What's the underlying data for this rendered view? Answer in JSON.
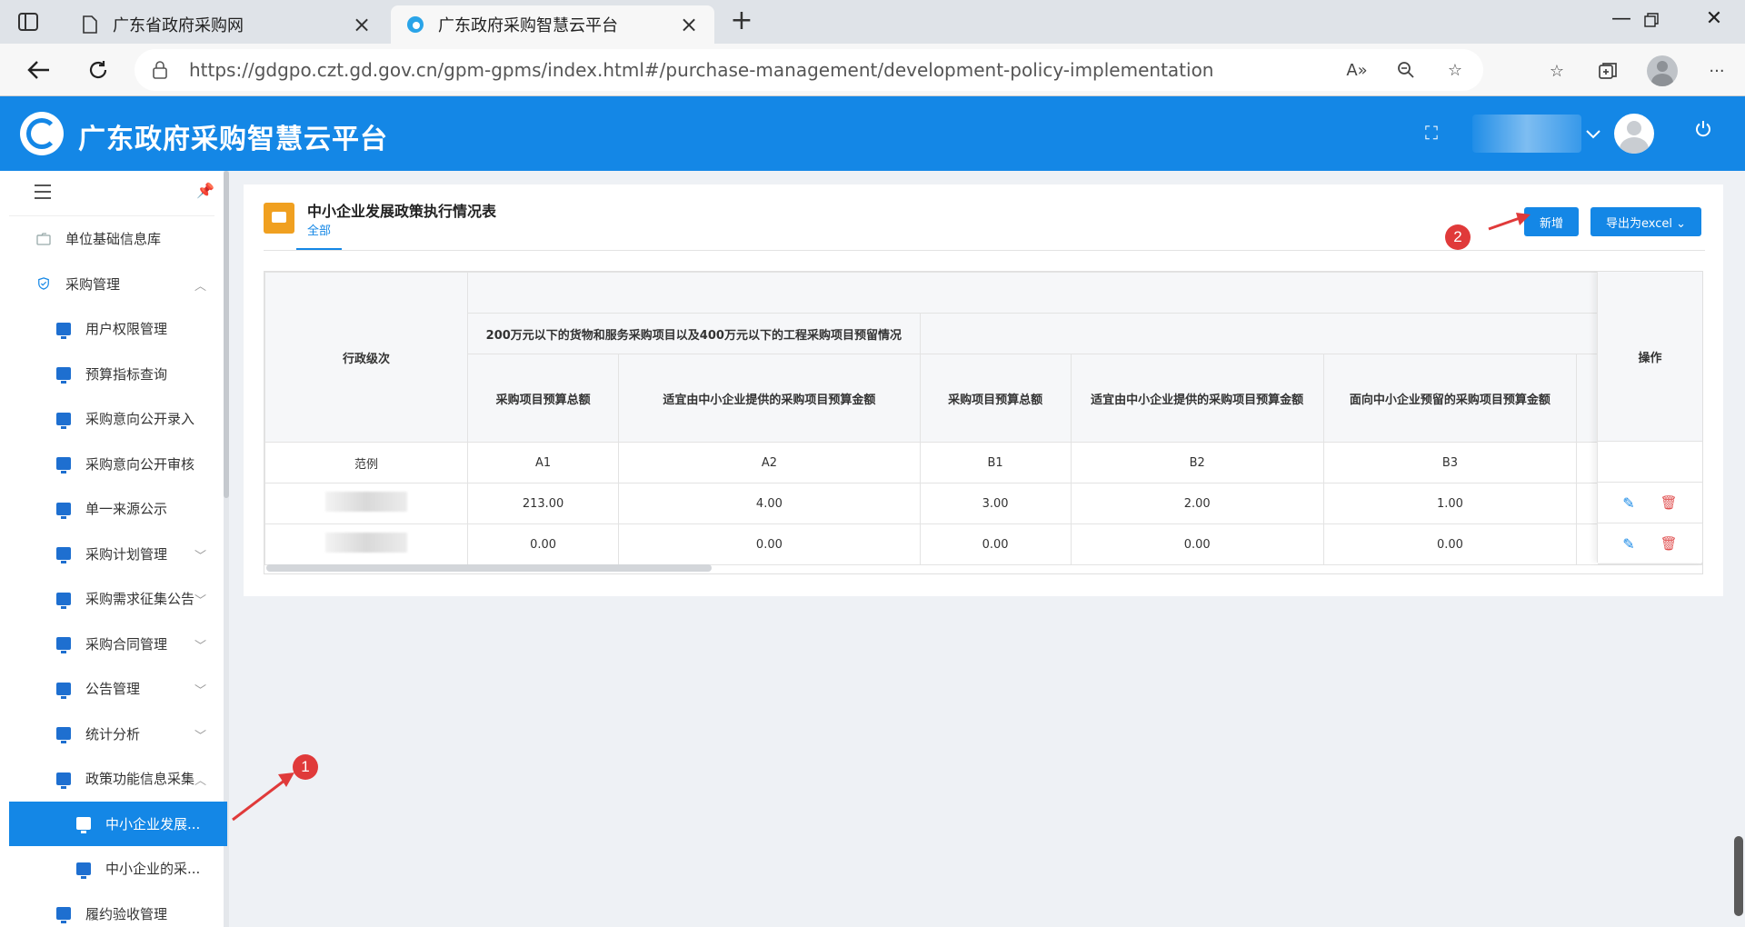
{
  "browser": {
    "tabs": [
      {
        "label": "广东省政府采购网",
        "active": false
      },
      {
        "label": "广东政府采购智慧云平台",
        "active": true
      }
    ],
    "url": "https://gdgpo.czt.gd.gov.cn/gpm-gpms/index.html#/purchase-management/development-policy-implementation",
    "icons": [
      "sidebar-toggle-icon",
      "document-icon",
      "edge-icon",
      "close-icon",
      "plus-icon",
      "minimize-icon",
      "restore-icon",
      "back-icon",
      "refresh-icon",
      "lock-icon",
      "read-aloud-icon",
      "zoom-icon",
      "favorite-add-icon",
      "favorites-icon",
      "collections-icon",
      "profile-icon",
      "more-icon"
    ]
  },
  "app": {
    "title": "广东政府采购智慧云平台",
    "brand_color": "#1487e6"
  },
  "sidebar": {
    "items": [
      {
        "label": "单位基础信息库",
        "level": 1
      },
      {
        "label": "采购管理",
        "level": 1,
        "expanded": true
      },
      {
        "label": "用户权限管理",
        "level": 2
      },
      {
        "label": "预算指标查询",
        "level": 2
      },
      {
        "label": "采购意向公开录入",
        "level": 2
      },
      {
        "label": "采购意向公开审核",
        "level": 2
      },
      {
        "label": "单一来源公示",
        "level": 2
      },
      {
        "label": "采购计划管理",
        "level": 2,
        "chevron": "down"
      },
      {
        "label": "采购需求征集公告",
        "level": 2,
        "chevron": "down"
      },
      {
        "label": "采购合同管理",
        "level": 2,
        "chevron": "down"
      },
      {
        "label": "公告管理",
        "level": 2,
        "chevron": "down"
      },
      {
        "label": "统计分析",
        "level": 2,
        "chevron": "down"
      },
      {
        "label": "政策功能信息采集",
        "level": 2,
        "chevron": "up"
      },
      {
        "label": "中小企业发展...",
        "level": 3,
        "selected": true
      },
      {
        "label": "中小企业的采...",
        "level": 3
      },
      {
        "label": "履约验收管理",
        "level": 2
      }
    ]
  },
  "panel": {
    "title": "中小企业发展政策执行情况表",
    "subtab": "全部",
    "add_button": "新增",
    "export_button": "导出为excel"
  },
  "table": {
    "group_header": "200万元以下的货物和服务采购项目以及400万元以下的工程采购项目预留情况",
    "col_region": "行政级次",
    "col_op": "操作",
    "columns": [
      "采购项目预算总额",
      "适宜由中小企业提供的采购项目预算金额",
      "采购项目预算总额",
      "适宜由中小企业提供的采购项目预算金额",
      "面向中小企业预留的采购项目预算金额"
    ],
    "rows": [
      {
        "region": "范例",
        "values": [
          "A1",
          "A2",
          "B1",
          "B2",
          "B3"
        ],
        "has_ops": false
      },
      {
        "region": "",
        "values": [
          "213.00",
          "4.00",
          "3.00",
          "2.00",
          "1.00"
        ],
        "has_ops": true
      },
      {
        "region": "",
        "values": [
          "0.00",
          "0.00",
          "0.00",
          "0.00",
          "0.00"
        ],
        "has_ops": true
      }
    ]
  },
  "annotations": [
    "1",
    "2"
  ],
  "annotation_color": "#e03a3a"
}
